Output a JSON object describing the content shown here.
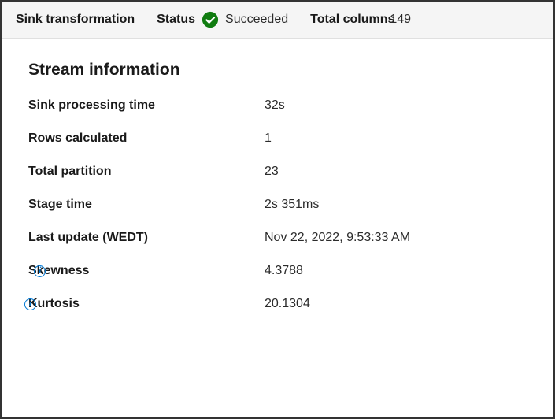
{
  "header": {
    "transformation_label": "Sink transformation",
    "status_label": "Status",
    "status_value": "Succeeded",
    "total_columns_label": "Total columns",
    "total_columns_value": "149"
  },
  "section_title": "Stream information",
  "info": {
    "rows": [
      {
        "label": "Sink processing time",
        "value": "32s",
        "has_info": false
      },
      {
        "label": "Rows calculated",
        "value": "1",
        "has_info": false
      },
      {
        "label": "Total partition",
        "value": "23",
        "has_info": false
      },
      {
        "label": "Stage time",
        "value": "2s 351ms",
        "has_info": false
      },
      {
        "label": "Last update (WEDT)",
        "value": "Nov 22, 2022, 9:53:33 AM",
        "has_info": false
      },
      {
        "label": "Skewness",
        "value": "4.3788",
        "has_info": true
      },
      {
        "label": "Kurtosis",
        "value": "20.1304",
        "has_info": true
      }
    ]
  },
  "colors": {
    "success": "#107c10",
    "info_icon": "#0078d4"
  }
}
